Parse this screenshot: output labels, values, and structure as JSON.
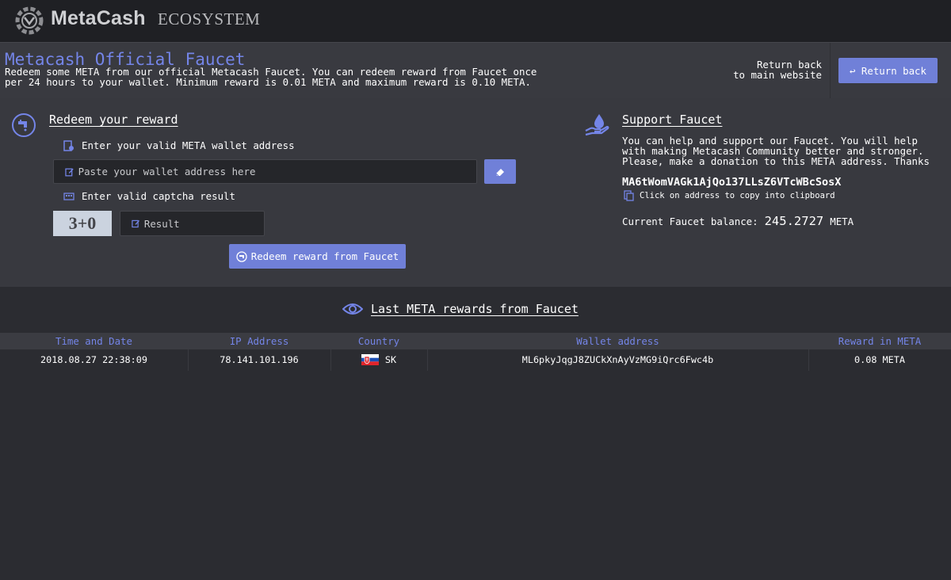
{
  "topbar": {
    "brand": "MetaCash",
    "brand_sub": "ECOSYSTEM"
  },
  "header": {
    "title": "Metacash Official Faucet",
    "description": "Redeem some META from our official Metacash Faucet. You can redeem reward from Faucet once per 24 hours to your wallet. Minimum reward is 0.01 META and maximum reward is 0.10 META.",
    "return_text_line1": "Return back",
    "return_text_line2": "to main website",
    "return_button": "↩ Return back"
  },
  "redeem": {
    "title": "Redeem your reward",
    "wallet_label": "Enter your valid META wallet address",
    "wallet_placeholder": "Paste your wallet address here",
    "wallet_value": "",
    "captcha_label": "Enter valid captcha result",
    "captcha": "3+0",
    "result_placeholder": "Result",
    "result_value": "",
    "submit_button": "Redeem reward from Faucet"
  },
  "support": {
    "title": "Support Faucet",
    "description": "You can help and support our Faucet. You will help with making Metacash Community better and stronger. Please, make a donation to this META address. Thanks",
    "address": "MA6tWomVAGk1AjQo137LLsZ6VTcWBcSosX",
    "copy_hint": "Click on address to copy into clipboard",
    "balance_label": "Current Faucet balance:",
    "balance_value": "245.2727",
    "balance_unit": "META"
  },
  "rewards": {
    "title": "Last META rewards from Faucet",
    "columns": [
      "Time and Date",
      "IP Address",
      "Country",
      "Wallet address",
      "Reward in META"
    ],
    "rows": [
      {
        "time": "2018.08.27 22:38:09",
        "ip": "78.141.101.196",
        "country": "SK",
        "wallet": "ML6pkyJqgJ8ZUCkXnAyVzMG9iQrc6Fwc4b",
        "reward": "0.08 META"
      }
    ]
  },
  "colors": {
    "accent": "#7485e8",
    "button": "#7080d8",
    "background": "#2b2c31",
    "panel": "#38393f",
    "topbar": "#1f2024"
  },
  "icons": {
    "logo": "gear-logo-icon",
    "redeem": "faucet-tap-icon",
    "wallet": "wallet-document-icon",
    "eraser": "eraser-icon",
    "captcha": "keyboard-icon",
    "edit": "edit-pencil-icon",
    "support": "hand-droplet-icon",
    "copy": "copy-icon",
    "eye": "eye-icon"
  }
}
